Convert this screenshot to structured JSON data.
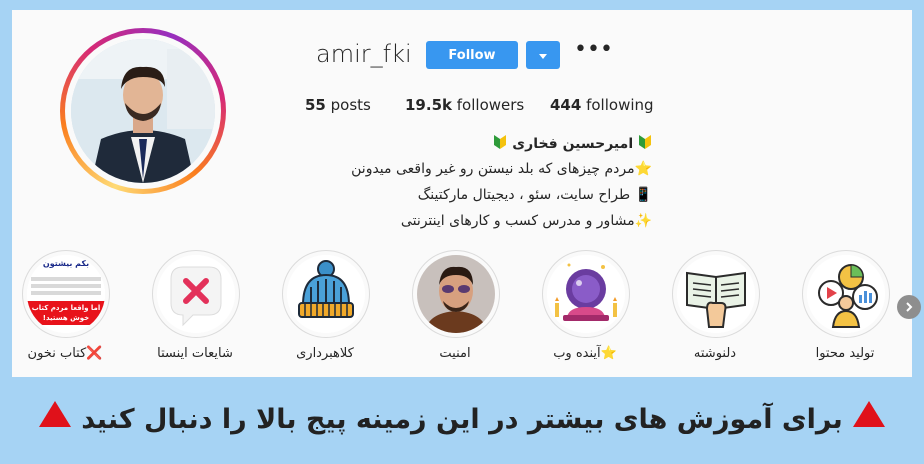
{
  "profile": {
    "username": "amir_fki",
    "follow_label": "Follow",
    "more_label": "•••",
    "posts": {
      "count": "55",
      "label": "posts"
    },
    "followers": {
      "count": "19.5k",
      "label": "followers"
    },
    "following": {
      "count": "444",
      "label": "following"
    },
    "display_name": "امیرحسین فخاری",
    "bio_lines": [
      "⭐مردم چیزهای که بلد نیستن رو غیر واقعی میدونن",
      "📱 طراح سایت، سئو ، دیجیتال مارکتینگ",
      "✨مشاور و مدرس کسب و کارهای اینترنتی"
    ]
  },
  "highlights": [
    {
      "label": "❌کتاب نخون",
      "icon": "book-ad-icon"
    },
    {
      "label": "شایعات اینستا",
      "icon": "x-bubble-icon"
    },
    {
      "label": "کلاهبرداری",
      "icon": "beanie-hat-icon"
    },
    {
      "label": "امنیت",
      "icon": "person-icon"
    },
    {
      "label": "⭐آینده وب",
      "icon": "crystal-ball-icon"
    },
    {
      "label": "دلنوشته",
      "icon": "book-hand-icon"
    },
    {
      "label": "تولید محتوا",
      "icon": "content-icon"
    }
  ],
  "thumb_text": {
    "title": "بکم بیشتون",
    "red_line": "اما واقعا مردم کتاب خوش هستید!"
  },
  "banner": {
    "text": "برای آموزش های بیشتر در این زمینه پیج بالا را دنبال کنید",
    "color": "#e0111a"
  },
  "colors": {
    "follow": "#3897f0",
    "background": "#a6d3f4"
  }
}
